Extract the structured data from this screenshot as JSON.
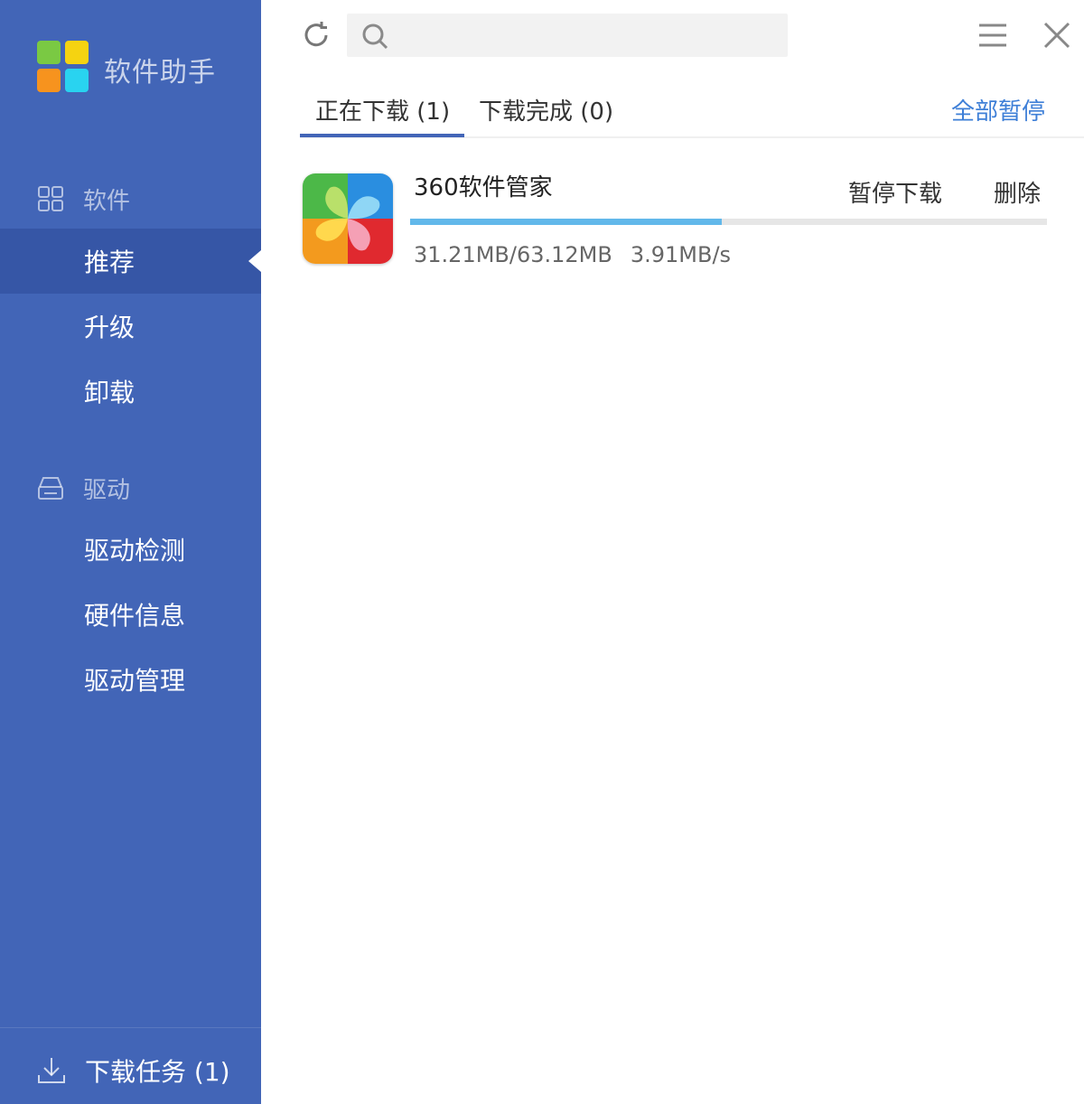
{
  "app": {
    "title": "软件助手"
  },
  "sidebar": {
    "software_section": "软件",
    "software_items": [
      {
        "label": "推荐",
        "active": true
      },
      {
        "label": "升级",
        "active": false
      },
      {
        "label": "卸载",
        "active": false
      }
    ],
    "driver_section": "驱动",
    "driver_items": [
      {
        "label": "驱动检测"
      },
      {
        "label": "硬件信息"
      },
      {
        "label": "驱动管理"
      }
    ],
    "download_tasks": "下载任务 (1)",
    "background_color": "#4265b7",
    "active_color": "#3656a6"
  },
  "toolbar": {
    "search_placeholder": "",
    "icons": [
      "refresh-icon",
      "search-icon",
      "menu-icon",
      "close-icon"
    ]
  },
  "tabs": [
    {
      "label": "正在下载 (1)",
      "active": true
    },
    {
      "label": "下载完成 (0)",
      "active": false
    }
  ],
  "pause_all": "全部暂停",
  "downloads": [
    {
      "name": "360软件管家",
      "progress": 0.49,
      "downloaded": "31.21MB/63.12MB",
      "speed": "3.91MB/s",
      "pause_label": "暂停下载",
      "delete_label": "删除"
    }
  ],
  "colors": {
    "accent": "#4265b7",
    "link": "#3e7fd7",
    "progress": "#62b8ea"
  }
}
